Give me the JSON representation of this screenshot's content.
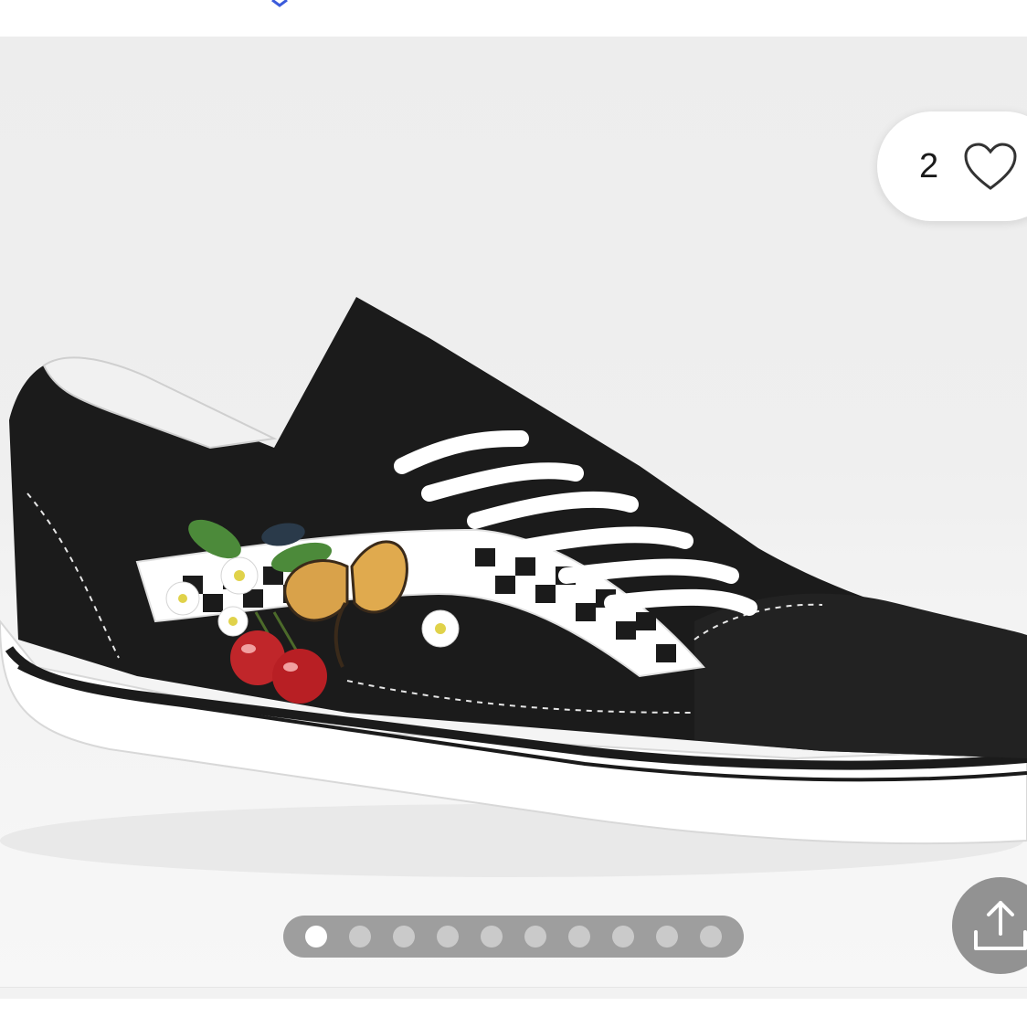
{
  "listing": {
    "like_count": "2",
    "like_icon": "heart-outline-icon",
    "share_icon": "share-upload-icon"
  },
  "gallery": {
    "image_count": 10,
    "active_index": 0
  },
  "colors": {
    "accent": "#3b5bdb",
    "pager_bg": "#808080",
    "shoe_black": "#1b1b1b"
  }
}
